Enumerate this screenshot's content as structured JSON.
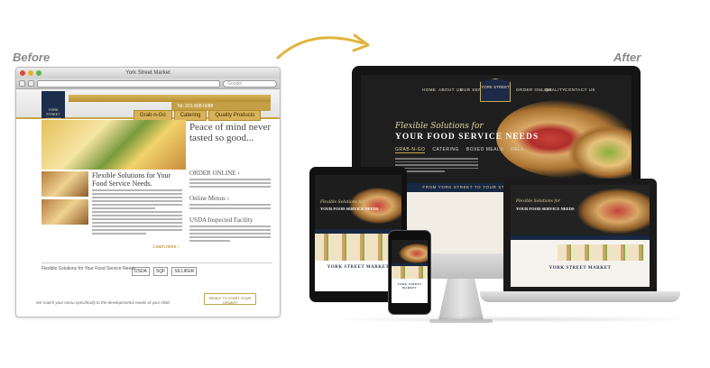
{
  "labels": {
    "before": "Before",
    "after": "After"
  },
  "old_site": {
    "window_title": "York Street Market",
    "search_placeholder": "Google",
    "logo_text": "YORK STREET MARKET",
    "phone": "Tel: 201-808-0088",
    "nav": [
      "Grab-n-Go",
      "Catering",
      "Quality Products"
    ],
    "tagline": "Peace of mind never tasted so good...",
    "body_title": "Flexible Solutions for Your Food Service Needs.",
    "side_headings": [
      "ORDER ONLINE ›",
      "Online Menus ›",
      "USDA Inspected Facility"
    ],
    "learn_more": "Learn more ›",
    "footer_title": "Flexible Solutions for Your Food Service Needs.",
    "badges": [
      "USDA",
      "SQF",
      "SILLIKER"
    ],
    "bottom_text": "We match your menu specifically to the developmental needs of your child",
    "bottom_button": "READY TO START YOUR ORDER?"
  },
  "new_site": {
    "nav_left": [
      "HOME",
      "ABOUT US",
      "OUR SERVICES"
    ],
    "nav_right": [
      "ORDER ONLINE",
      "QUALITY",
      "CONTACT US"
    ],
    "badge": "YORK STREET",
    "subtitle_script": "Flexible Solutions for",
    "subtitle_main": "YOUR FOOD SERVICE NEEDS",
    "links": [
      "GRAB-N-GO",
      "CATERING",
      "BOXED MEALS",
      "DELI"
    ],
    "strip_text": "FROM YORK STREET TO YOUR STREET, FUELING THE DRIVE",
    "logo": "YORK STREET MARKET"
  },
  "colors": {
    "gold": "#c8a951",
    "navy": "#182742",
    "old_gold_nav": "#d8b35a"
  }
}
